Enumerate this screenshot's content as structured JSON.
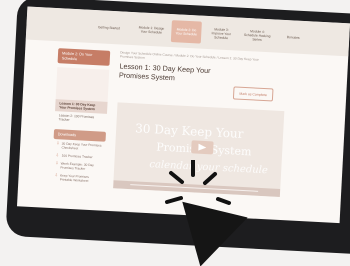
{
  "nav": {
    "items": [
      {
        "label": "Getting Started"
      },
      {
        "label": "Module 1: Design Your Schedule"
      },
      {
        "label": "Module 2: Do Your Schedule"
      },
      {
        "label": "Module 3: Improve Your Schedule"
      },
      {
        "label": "Module 4: Schedule Hacking Series"
      },
      {
        "label": "Bonuses"
      }
    ]
  },
  "sidebar": {
    "heading": "Module 2: Do Your Schedule",
    "items": [
      {
        "label": "Lesson 1: 30 Day Keep Your Promises System"
      },
      {
        "label": "Lesson 2: 100 Promises Tracker"
      }
    ],
    "downloads_title": "Downloads",
    "downloads": [
      {
        "label": "30 Day Keep Your Promises Checksheet"
      },
      {
        "label": "100 Promises Tracker"
      },
      {
        "label": "Week Example: 30 Day Promises Tracker"
      },
      {
        "label": "Keep Your Promises Printable Worksheet"
      }
    ]
  },
  "main": {
    "breadcrumb": "Design Your Schedule Online Course / Module 2: Do Your Schedule / Lesson 1: 30 Day Keep Your Promises System",
    "lesson_title": "Lesson 1: 30 Day Keep Your Promises System",
    "mark_complete": "Mark as Complete",
    "video": {
      "line1": "30 Day Keep Your",
      "line2": "Promises System",
      "line3": "calendar your schedule"
    }
  }
}
